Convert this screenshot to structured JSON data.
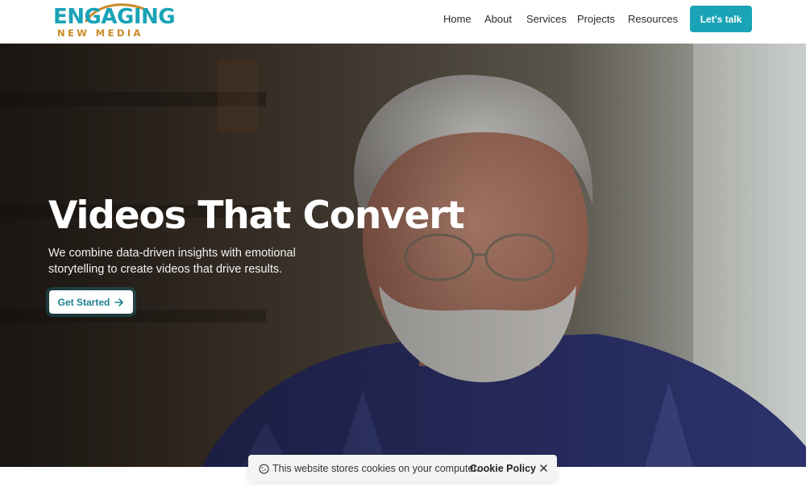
{
  "logo": {
    "line1": "ENGAGING",
    "line2": "NEW MEDIA"
  },
  "nav": {
    "items": [
      "Home",
      "About",
      "Services",
      "Projects",
      "Resources"
    ],
    "cta_label": "Let's talk"
  },
  "hero": {
    "title": "Videos That Convert",
    "subtitle": "We combine data-driven insights with emotional storytelling to create videos that drive results.",
    "button_label": "Get Started",
    "button_icon": "arrow-right-icon",
    "background": "man-portrait-photo"
  },
  "cookie": {
    "text": "This website stores cookies on your computer.",
    "link_label": "Cookie Policy",
    "icon": "cookie-icon",
    "close_icon": "close-icon"
  },
  "colors": {
    "brand_teal": "#1aa3b6",
    "brand_gold": "#c98a27",
    "text_dark": "#2b2b2b"
  }
}
